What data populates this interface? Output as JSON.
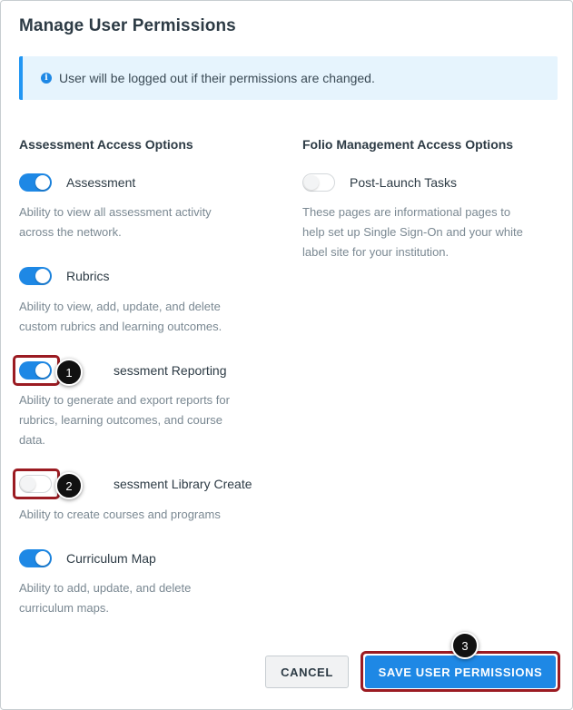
{
  "dialog": {
    "title": "Manage User Permissions",
    "info_banner": "User will be logged out if their permissions are changed."
  },
  "left_column": {
    "heading": "Assessment Access Options",
    "items": [
      {
        "label": "Assessment",
        "enabled": true,
        "description": [
          "Ability to view all assessment activity",
          "across the network."
        ]
      },
      {
        "label": "Rubrics",
        "enabled": true,
        "description": [
          "Ability to view, add, update, and delete",
          "custom rubrics and learning outcomes."
        ]
      },
      {
        "label": "sessment Reporting",
        "enabled": true,
        "description": [
          "Ability to generate and export reports for",
          "rubrics, learning outcomes, and course",
          "data."
        ]
      },
      {
        "label": "sessment Library Create",
        "enabled": false,
        "description": [
          "Ability to create courses and programs"
        ]
      },
      {
        "label": "Curriculum Map",
        "enabled": true,
        "description": [
          "Ability to add, update, and delete",
          "curriculum maps."
        ]
      }
    ]
  },
  "right_column": {
    "heading": "Folio Management Access Options",
    "items": [
      {
        "label": "Post-Launch Tasks",
        "enabled": false,
        "description": [
          "These pages are informational pages to",
          "help set up Single Sign-On and your white",
          "label site for your institution."
        ]
      }
    ]
  },
  "callouts": [
    "1",
    "2",
    "3"
  ],
  "buttons": {
    "cancel": "CANCEL",
    "save": "SAVE USER PERMISSIONS"
  },
  "colors": {
    "accent": "#1e88e5",
    "highlight": "#9b1b22",
    "banner_bg": "#e6f4fd"
  }
}
